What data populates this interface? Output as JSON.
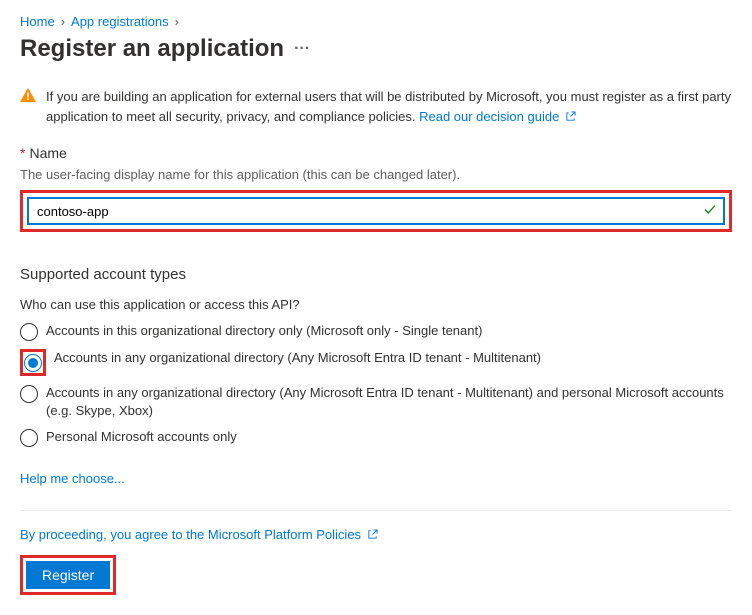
{
  "breadcrumb": {
    "home": "Home",
    "app_reg": "App registrations"
  },
  "title": "Register an application",
  "warning": {
    "text": "If you are building an application for external users that will be distributed by Microsoft, you must register as a first party application to meet all security, privacy, and compliance policies. ",
    "link": "Read our decision guide"
  },
  "name_section": {
    "label": "Name",
    "hint": "The user-facing display name for this application (this can be changed later).",
    "value": "contoso-app"
  },
  "account_types": {
    "title": "Supported account types",
    "question": "Who can use this application or access this API?",
    "options": [
      "Accounts in this organizational directory only (Microsoft only - Single tenant)",
      "Accounts in any organizational directory (Any Microsoft Entra ID tenant - Multitenant)",
      "Accounts in any organizational directory (Any Microsoft Entra ID tenant - Multitenant) and personal Microsoft accounts (e.g. Skype, Xbox)",
      "Personal Microsoft accounts only"
    ],
    "help": "Help me choose..."
  },
  "footer": {
    "policy": "By proceeding, you agree to the Microsoft Platform Policies",
    "register": "Register"
  }
}
